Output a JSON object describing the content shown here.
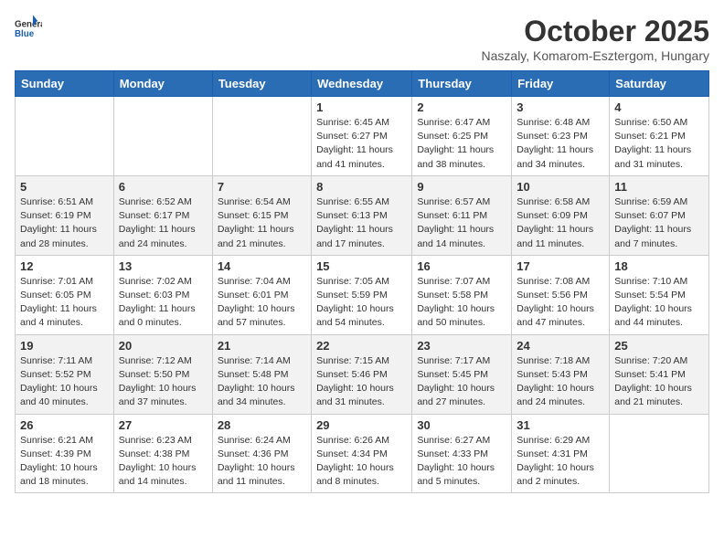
{
  "header": {
    "logo_general": "General",
    "logo_blue": "Blue",
    "month_year": "October 2025",
    "location": "Naszaly, Komarom-Esztergom, Hungary"
  },
  "days_of_week": [
    "Sunday",
    "Monday",
    "Tuesday",
    "Wednesday",
    "Thursday",
    "Friday",
    "Saturday"
  ],
  "weeks": [
    [
      {
        "day": "",
        "info": ""
      },
      {
        "day": "",
        "info": ""
      },
      {
        "day": "",
        "info": ""
      },
      {
        "day": "1",
        "info": "Sunrise: 6:45 AM\nSunset: 6:27 PM\nDaylight: 11 hours and 41 minutes."
      },
      {
        "day": "2",
        "info": "Sunrise: 6:47 AM\nSunset: 6:25 PM\nDaylight: 11 hours and 38 minutes."
      },
      {
        "day": "3",
        "info": "Sunrise: 6:48 AM\nSunset: 6:23 PM\nDaylight: 11 hours and 34 minutes."
      },
      {
        "day": "4",
        "info": "Sunrise: 6:50 AM\nSunset: 6:21 PM\nDaylight: 11 hours and 31 minutes."
      }
    ],
    [
      {
        "day": "5",
        "info": "Sunrise: 6:51 AM\nSunset: 6:19 PM\nDaylight: 11 hours and 28 minutes."
      },
      {
        "day": "6",
        "info": "Sunrise: 6:52 AM\nSunset: 6:17 PM\nDaylight: 11 hours and 24 minutes."
      },
      {
        "day": "7",
        "info": "Sunrise: 6:54 AM\nSunset: 6:15 PM\nDaylight: 11 hours and 21 minutes."
      },
      {
        "day": "8",
        "info": "Sunrise: 6:55 AM\nSunset: 6:13 PM\nDaylight: 11 hours and 17 minutes."
      },
      {
        "day": "9",
        "info": "Sunrise: 6:57 AM\nSunset: 6:11 PM\nDaylight: 11 hours and 14 minutes."
      },
      {
        "day": "10",
        "info": "Sunrise: 6:58 AM\nSunset: 6:09 PM\nDaylight: 11 hours and 11 minutes."
      },
      {
        "day": "11",
        "info": "Sunrise: 6:59 AM\nSunset: 6:07 PM\nDaylight: 11 hours and 7 minutes."
      }
    ],
    [
      {
        "day": "12",
        "info": "Sunrise: 7:01 AM\nSunset: 6:05 PM\nDaylight: 11 hours and 4 minutes."
      },
      {
        "day": "13",
        "info": "Sunrise: 7:02 AM\nSunset: 6:03 PM\nDaylight: 11 hours and 0 minutes."
      },
      {
        "day": "14",
        "info": "Sunrise: 7:04 AM\nSunset: 6:01 PM\nDaylight: 10 hours and 57 minutes."
      },
      {
        "day": "15",
        "info": "Sunrise: 7:05 AM\nSunset: 5:59 PM\nDaylight: 10 hours and 54 minutes."
      },
      {
        "day": "16",
        "info": "Sunrise: 7:07 AM\nSunset: 5:58 PM\nDaylight: 10 hours and 50 minutes."
      },
      {
        "day": "17",
        "info": "Sunrise: 7:08 AM\nSunset: 5:56 PM\nDaylight: 10 hours and 47 minutes."
      },
      {
        "day": "18",
        "info": "Sunrise: 7:10 AM\nSunset: 5:54 PM\nDaylight: 10 hours and 44 minutes."
      }
    ],
    [
      {
        "day": "19",
        "info": "Sunrise: 7:11 AM\nSunset: 5:52 PM\nDaylight: 10 hours and 40 minutes."
      },
      {
        "day": "20",
        "info": "Sunrise: 7:12 AM\nSunset: 5:50 PM\nDaylight: 10 hours and 37 minutes."
      },
      {
        "day": "21",
        "info": "Sunrise: 7:14 AM\nSunset: 5:48 PM\nDaylight: 10 hours and 34 minutes."
      },
      {
        "day": "22",
        "info": "Sunrise: 7:15 AM\nSunset: 5:46 PM\nDaylight: 10 hours and 31 minutes."
      },
      {
        "day": "23",
        "info": "Sunrise: 7:17 AM\nSunset: 5:45 PM\nDaylight: 10 hours and 27 minutes."
      },
      {
        "day": "24",
        "info": "Sunrise: 7:18 AM\nSunset: 5:43 PM\nDaylight: 10 hours and 24 minutes."
      },
      {
        "day": "25",
        "info": "Sunrise: 7:20 AM\nSunset: 5:41 PM\nDaylight: 10 hours and 21 minutes."
      }
    ],
    [
      {
        "day": "26",
        "info": "Sunrise: 6:21 AM\nSunset: 4:39 PM\nDaylight: 10 hours and 18 minutes."
      },
      {
        "day": "27",
        "info": "Sunrise: 6:23 AM\nSunset: 4:38 PM\nDaylight: 10 hours and 14 minutes."
      },
      {
        "day": "28",
        "info": "Sunrise: 6:24 AM\nSunset: 4:36 PM\nDaylight: 10 hours and 11 minutes."
      },
      {
        "day": "29",
        "info": "Sunrise: 6:26 AM\nSunset: 4:34 PM\nDaylight: 10 hours and 8 minutes."
      },
      {
        "day": "30",
        "info": "Sunrise: 6:27 AM\nSunset: 4:33 PM\nDaylight: 10 hours and 5 minutes."
      },
      {
        "day": "31",
        "info": "Sunrise: 6:29 AM\nSunset: 4:31 PM\nDaylight: 10 hours and 2 minutes."
      },
      {
        "day": "",
        "info": ""
      }
    ]
  ]
}
